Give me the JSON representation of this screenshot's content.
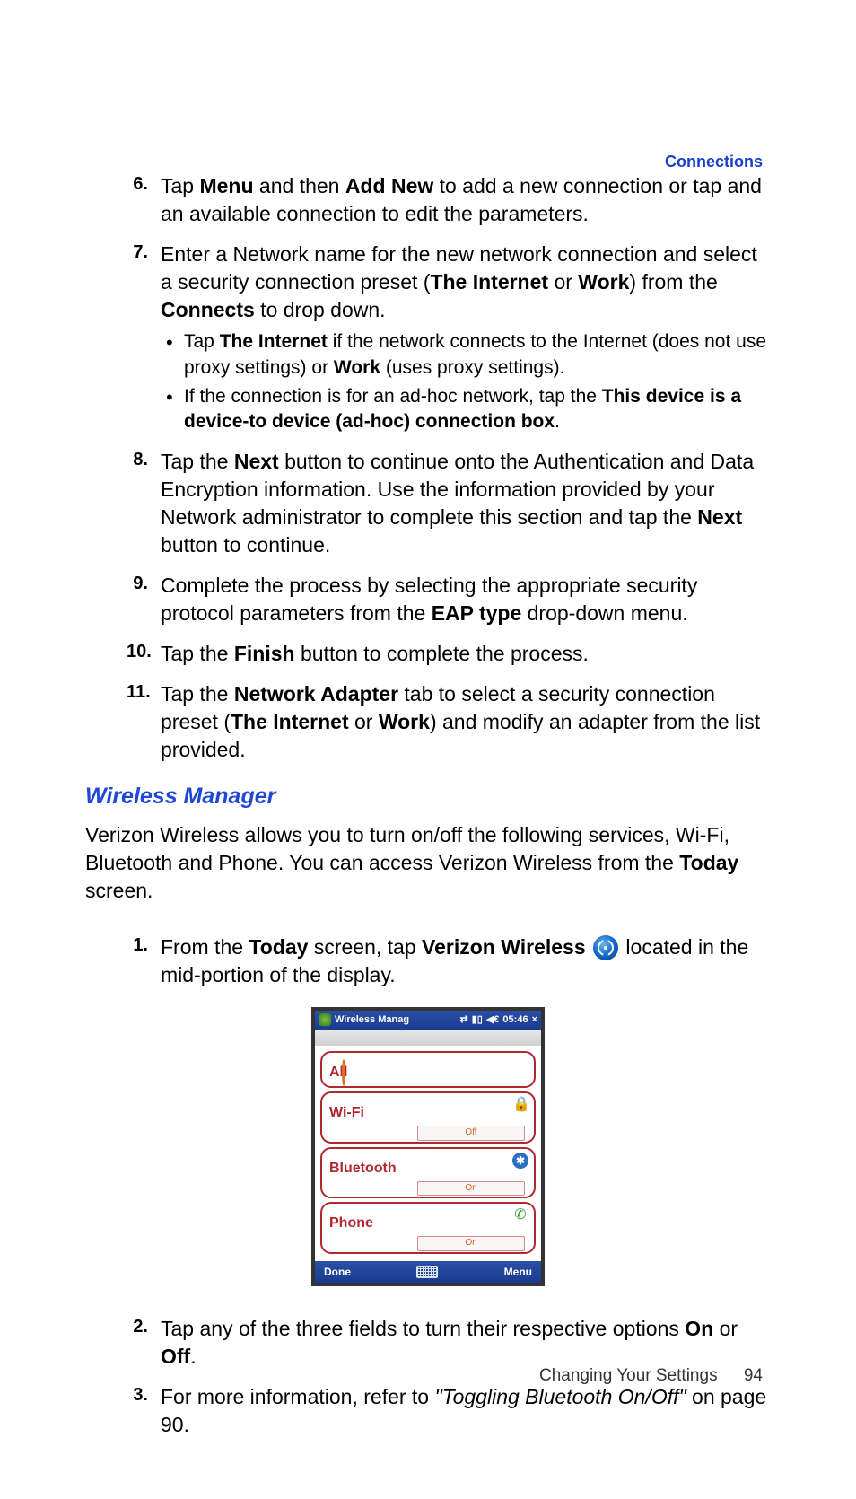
{
  "header_label": "Connections",
  "steps_a": [
    {
      "n": "6.",
      "text": "Tap <b>Menu</b> and then <b>Add New</b> to add a new connection or tap and an available connection to edit the parameters."
    },
    {
      "n": "7.",
      "text": "Enter a Network name for the new network connection and select a security connection preset (<b>The Internet</b> or <b>Work</b>) from the <b>Connects</b> to drop down.",
      "bullets": [
        "Tap <b>The Internet</b> if the network connects to the Internet (does not use proxy settings) or <b>Work</b> (uses proxy settings).",
        "If the connection is for an ad-hoc network, tap the <b>This device is a device-to device (ad-hoc) connection box</b>."
      ]
    },
    {
      "n": "8.",
      "text": "Tap the <b>Next</b> button to continue onto the Authentication and Data Encryption information. Use the information provided by your Network administrator to complete this section and tap the <b>Next</b> button to continue."
    },
    {
      "n": "9.",
      "text": "Complete the process by selecting the appropriate security protocol parameters from the <b>EAP type</b> drop-down menu."
    },
    {
      "n": "10.",
      "text": "Tap the <b>Finish</b> button to complete the process."
    },
    {
      "n": "11.",
      "text": "Tap the <b>Network Adapter</b> tab to select a security connection preset (<b>The Internet</b> or <b>Work</b>) and modify an adapter from the list provided."
    }
  ],
  "section_heading": "Wireless Manager",
  "intro": "Verizon Wireless allows you to turn on/off the following services, Wi-Fi, Bluetooth and Phone. You can access Verizon Wireless from the <b>Today</b> screen.",
  "steps_b": [
    {
      "n": "1.",
      "text": "From the <b>Today</b> screen, tap <b>Verizon Wireless</b> {ICON} located in the mid-portion of the display."
    }
  ],
  "steps_c": [
    {
      "n": "2.",
      "text": "Tap any of the three fields to turn their respective options <b>On</b> or <b>Off</b>."
    },
    {
      "n": "3.",
      "text": "For more information, refer to <em>\"Toggling Bluetooth On/Off\"</em> on page 90."
    }
  ],
  "device": {
    "title": "Wireless Manag",
    "time": "05:46",
    "rows": {
      "all": {
        "label": "All"
      },
      "wifi": {
        "label": "Wi-Fi",
        "state": "Off"
      },
      "bluetooth": {
        "label": "Bluetooth",
        "state": "On"
      },
      "phone": {
        "label": "Phone",
        "state": "On"
      }
    },
    "bottom": {
      "done": "Done",
      "menu": "Menu"
    }
  },
  "footer": {
    "chapter": "Changing Your Settings",
    "page": "94"
  }
}
